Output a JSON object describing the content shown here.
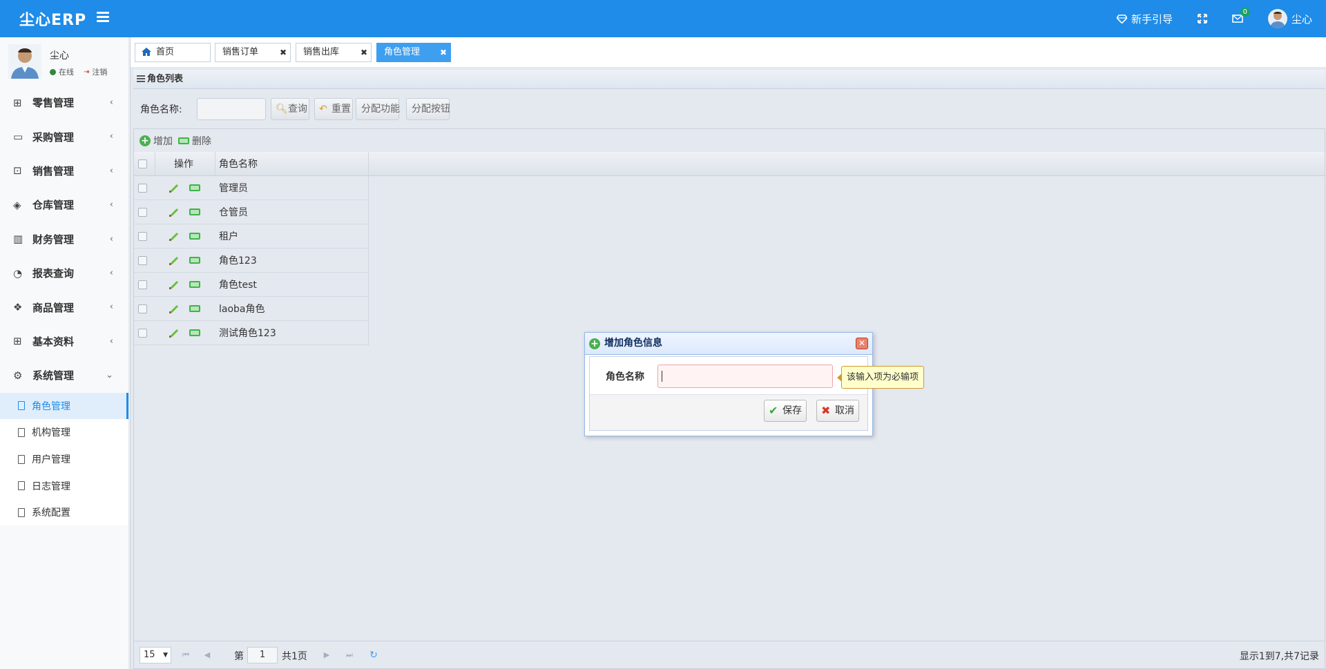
{
  "header": {
    "logo": "尘心ERP",
    "guide_label": "新手引导",
    "msg_count": "0",
    "username": "尘心"
  },
  "sidebar": {
    "user": {
      "name": "尘心",
      "online": "在线",
      "logout": "注销"
    },
    "menus": [
      {
        "label": "零售管理",
        "icon": "gift-icon"
      },
      {
        "label": "采购管理",
        "icon": "monitor-icon"
      },
      {
        "label": "销售管理",
        "icon": "briefcase-icon"
      },
      {
        "label": "仓库管理",
        "icon": "layers-icon"
      },
      {
        "label": "财务管理",
        "icon": "map-icon"
      },
      {
        "label": "报表查询",
        "icon": "pie-chart-icon"
      },
      {
        "label": "商品管理",
        "icon": "dropbox-icon"
      },
      {
        "label": "基本资料",
        "icon": "grid-icon"
      },
      {
        "label": "系统管理",
        "icon": "gear-icon"
      }
    ],
    "submenu": [
      "角色管理",
      "机构管理",
      "用户管理",
      "日志管理",
      "系统配置"
    ]
  },
  "tabs": [
    "首页",
    "销售订单",
    "销售出库",
    "角色管理"
  ],
  "panel": {
    "title": "角色列表"
  },
  "search": {
    "label": "角色名称:",
    "query_btn": "查询",
    "reset_btn": "重置",
    "assign_func_btn": "分配功能",
    "assign_btn_btn": "分配按钮"
  },
  "toolbar": {
    "add": "增加",
    "delete": "删除"
  },
  "grid": {
    "col_ops": "操作",
    "col_name": "角色名称",
    "rows": [
      "管理员",
      "仓管员",
      "租户",
      "角色123",
      "角色test",
      "laoba角色",
      "测试角色123"
    ]
  },
  "pager": {
    "page_size": "15",
    "page_prefix": "第",
    "page_num": "1",
    "page_total": "共1页",
    "info": "显示1到7,共7记录"
  },
  "dialog": {
    "title": "增加角色信息",
    "field_label": "角色名称",
    "tooltip": "该输入项为必输项",
    "save": "保存",
    "cancel": "取消"
  }
}
